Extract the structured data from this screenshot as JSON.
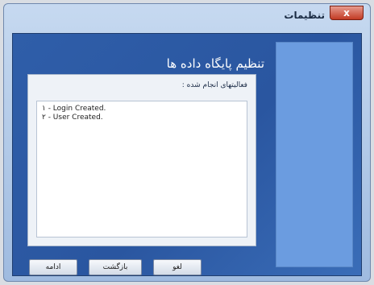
{
  "window": {
    "title": "تنظیمات",
    "close_glyph": "x"
  },
  "main": {
    "heading": "تنظیم پایگاه داده ها",
    "operations_label": "فعالیتهای انجام شده :",
    "log": [
      "۱ - Login Created.",
      "۲ - User Created."
    ]
  },
  "buttons": {
    "continue_label": "ادامه",
    "back_label": "بازگشت",
    "cancel_label": "لغو"
  },
  "colors": {
    "client_background": "#2f5ea9",
    "side_panel": "#6b9ce0",
    "close_button": "#c23b24"
  }
}
